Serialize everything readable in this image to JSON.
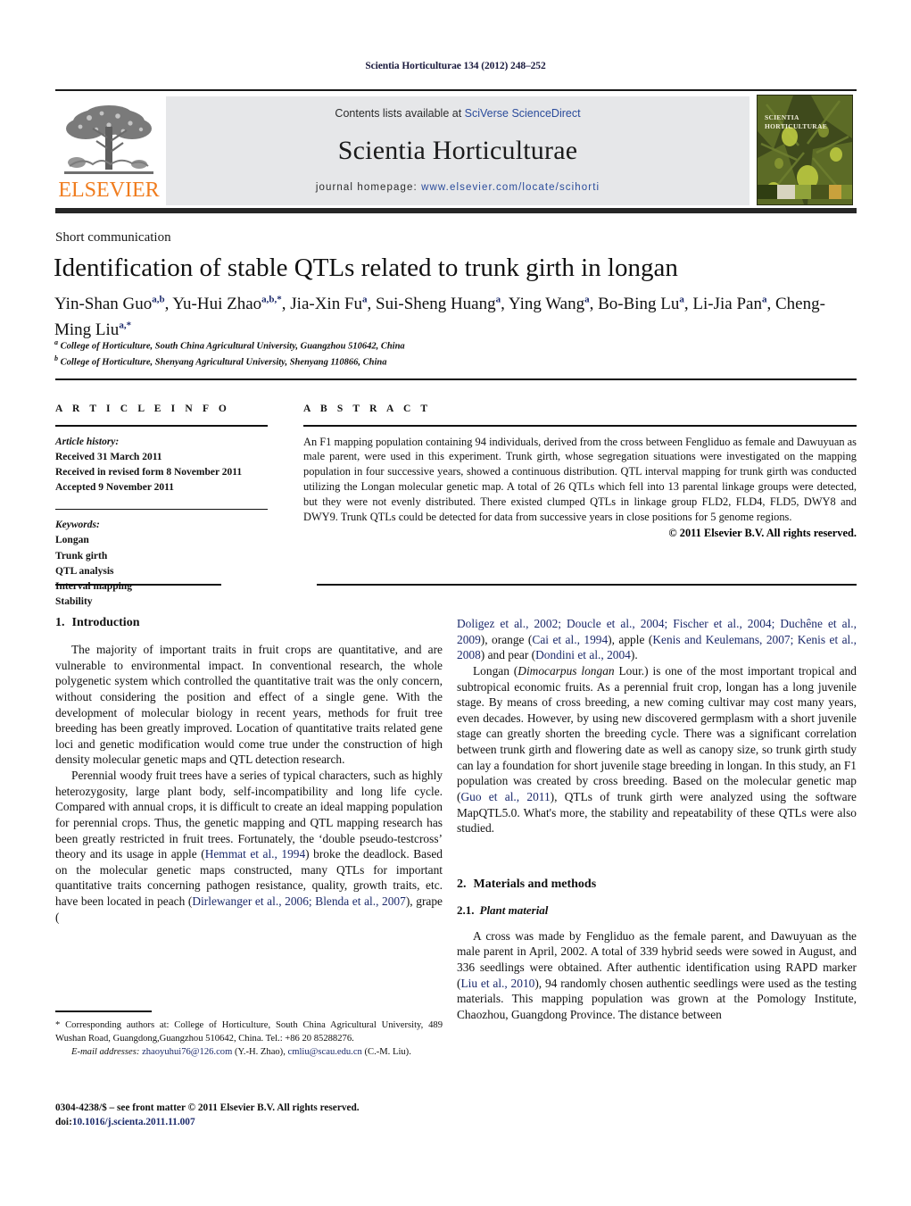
{
  "running_head": "Scientia Horticulturae 134 (2012) 248–252",
  "masthead": {
    "contents_prefix": "Contents lists available at ",
    "contents_link": "SciVerse ScienceDirect",
    "journal_title": "Scientia Horticulturae",
    "homepage_prefix": "journal homepage: ",
    "homepage_link": "www.elsevier.com/locate/scihorti",
    "publisher_logo_text": "ELSEVIER",
    "cover_title_line1": "SCIENTIA",
    "cover_title_line2": "HORTICULTURAE",
    "colors": {
      "band_bg": "#e6e7e9",
      "link": "#2a4b9b",
      "elsevier_orange": "#f07c1e"
    }
  },
  "article": {
    "type": "Short communication",
    "title": "Identification of stable QTLs related to trunk girth in longan",
    "authors_line1": "Yin-Shan Guo",
    "authors": "Yin-Shan Guo a,b, Yu-Hui Zhao a,b,*, Jia-Xin Fu a, Sui-Sheng Huang a, Ying Wang a, Bo-Bing Lu a, Li-Jia Pan a, Cheng-Ming Liu a,*",
    "affiliation_a": "College of Horticulture, South China Agricultural University, Guangzhou 510642, China",
    "affiliation_b": "College of Horticulture, Shenyang Agricultural University, Shenyang 110866, China"
  },
  "article_info": {
    "heading": "A R T I C L E   I N F O",
    "history_label": "Article history:",
    "history": [
      "Received 31 March 2011",
      "Received in revised form 8 November 2011",
      "Accepted 9 November 2011"
    ],
    "keywords_label": "Keywords:",
    "keywords": [
      "Longan",
      "Trunk girth",
      "QTL analysis",
      "Interval mapping",
      "Stability"
    ]
  },
  "abstract": {
    "heading": "A B S T R A C T",
    "text": "An F1 mapping population containing 94 individuals, derived from the cross between Fengliduo as female and Dawuyuan as male parent, were used in this experiment. Trunk girth, whose segregation situations were investigated on the mapping population in four successive years, showed a continuous distribution. QTL interval mapping for trunk girth was conducted utilizing the Longan molecular genetic map. A total of 26 QTLs which fell into 13 parental linkage groups were detected, but they were not evenly distributed. There existed clumped QTLs in linkage group FLD2, FLD4, FLD5, DWY8 and DWY9. Trunk QTLs could be detected for data from successive years in close positions for 5 genome regions.",
    "copyright": "© 2011 Elsevier B.V. All rights reserved."
  },
  "sections": {
    "intro_heading_num": "1.",
    "intro_heading": "Introduction",
    "intro_p1": "The majority of important traits in fruit crops are quantitative, and are vulnerable to environmental impact. In conventional research, the whole polygenetic system which controlled the quantitative trait was the only concern, without considering the position and effect of a single gene. With the development of molecular biology in recent years, methods for fruit tree breeding has been greatly improved. Location of quantitative traits related gene loci and genetic modification would come true under the construction of high density molecular genetic maps and QTL detection research.",
    "intro_p2_a": "Perennial woody fruit trees have a series of typical characters, such as highly heterozygosity, large plant body, self-incompatibility and long life cycle. Compared with annual crops, it is difficult to create an ideal mapping population for perennial crops. Thus, the genetic mapping and QTL mapping research has been greatly restricted in fruit trees. Fortunately, the ‘double pseudo-testcross’ theory and its usage in apple (",
    "intro_p2_ref1": "Hemmat et al., 1994",
    "intro_p2_b": ") broke the deadlock. Based on the molecular genetic maps constructed, many QTLs for important quantitative traits concerning pathogen resistance, quality, growth traits, etc. have been located in peach (",
    "intro_p2_ref2": "Dirlewanger et al., 2006; Blenda et al., 2007",
    "intro_p2_c": "), grape (",
    "intro_p2_ref3": "Doligez et al., 2002; Doucle et al., 2004; Fischer et al., 2004; Duchêne et al., 2009",
    "intro_p2_d": "), orange (",
    "intro_p2_ref4": "Cai et al., 1994",
    "intro_p2_e": "), apple (",
    "intro_p2_ref5": "Kenis and Keulemans, 2007; Kenis et al., 2008",
    "intro_p2_f": ") and pear (",
    "intro_p2_ref6": "Dondini et al., 2004",
    "intro_p2_g": ").",
    "intro_p3_a": "Longan (",
    "intro_p3_italic": "Dimocarpus longan",
    "intro_p3_b": " Lour.) is one of the most important tropical and subtropical economic fruits. As a perennial fruit crop, longan has a long juvenile stage. By means of cross breeding, a new coming cultivar may cost many years, even decades. However, by using new discovered germplasm with a short juvenile stage can greatly shorten the breeding cycle. There was a significant correlation between trunk girth and flowering date as well as canopy size, so trunk girth study can lay a foundation for short juvenile stage breeding in longan. In this study, an F1 population was created by cross breeding. Based on the molecular genetic map (",
    "intro_p3_ref": "Guo et al., 2011",
    "intro_p3_c": "), QTLs of trunk girth were analyzed using the software MapQTL5.0. What's more, the stability and repeatability of these QTLs were also studied.",
    "methods_heading_num": "2.",
    "methods_heading": "Materials and methods",
    "plant_heading_num": "2.1.",
    "plant_heading": "Plant material",
    "plant_p1_a": "A cross was made by Fengliduo as the female parent, and Dawuyuan as the male parent in April, 2002. A total of 339 hybrid seeds were sowed in August, and 336 seedlings were obtained. After authentic identification using RAPD marker (",
    "plant_p1_ref": "Liu et al., 2010",
    "plant_p1_b": "), 94 randomly chosen authentic seedlings were used as the testing materials. This mapping population was grown at the Pomology Institute, Chaozhou, Guangdong Province. The distance between"
  },
  "footnotes": {
    "corresponding_a": "* Corresponding authors at: College of Horticulture, South China Agricultural University, 489 Wushan Road, Guangdong,Guangzhou 510642, China.",
    "corresponding_b": "Tel.: +86 20 85288276.",
    "email_label": "E-mail addresses:",
    "email1": "zhaoyuhui76@126.com",
    "email1_owner": "(Y.-H. Zhao),",
    "email2": "cmliu@scau.edu.cn",
    "email2_owner": "(C.-M. Liu).",
    "imprint_line1": "0304-4238/$ – see front matter © 2011 Elsevier B.V. All rights reserved.",
    "imprint_doi_label": "doi:",
    "imprint_doi": "10.1016/j.scienta.2011.11.007"
  }
}
